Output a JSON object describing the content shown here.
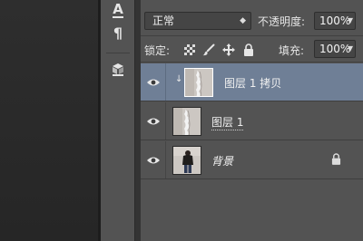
{
  "layers_panel": {
    "blend_mode": "正常",
    "opacity_label": "不透明度:",
    "opacity_value": "100%",
    "lock_label": "锁定:",
    "fill_label": "填充:",
    "fill_value": "100%",
    "lock_icons": [
      "lock-transparent-pixels-icon",
      "lock-image-pixels-icon",
      "lock-position-icon",
      "lock-all-icon"
    ],
    "layers": [
      {
        "name": "图层 1 拷贝",
        "selected": true,
        "visible": true
      },
      {
        "name": "图层 1",
        "selected": false,
        "visible": true
      },
      {
        "name": "背景",
        "selected": false,
        "visible": true,
        "locked": true
      }
    ]
  },
  "mini_toolbar": {
    "tools": [
      "character-panel-icon",
      "paragraph-icon",
      "3d-cube-icon"
    ],
    "character_glyph": "A",
    "paragraph_glyph": "¶"
  },
  "colors": {
    "panel_bg": "#535353",
    "selected_layer": "#6f7f96",
    "workspace_bg": "#2b2b2b"
  }
}
